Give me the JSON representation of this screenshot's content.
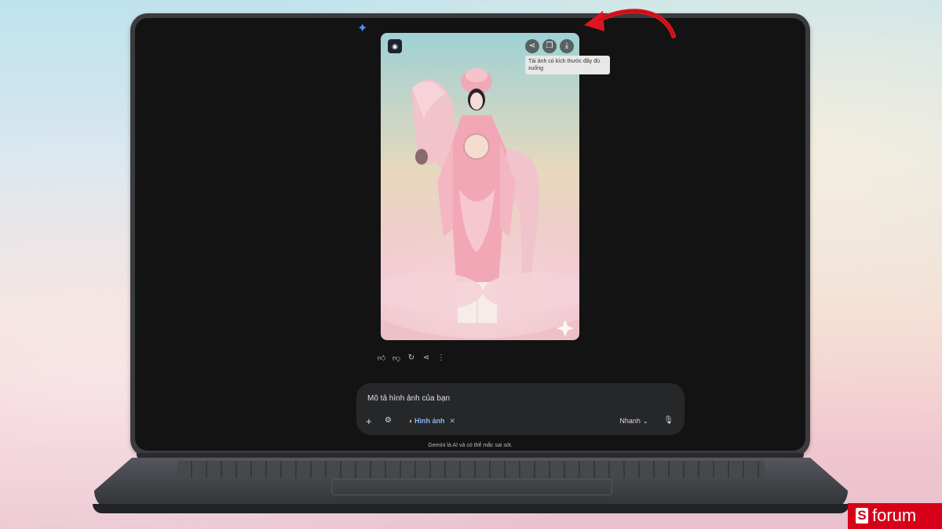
{
  "image_toolbar": {
    "share_icon": "share-icon",
    "copy_icon": "copy-icon",
    "download_icon": "download-icon",
    "download_tooltip": "Tải ảnh có kích thước đầy đủ xuống"
  },
  "response_actions": [
    "thumbs-up-icon",
    "thumbs-down-icon",
    "refresh-icon",
    "share-icon",
    "more-icon"
  ],
  "composer": {
    "placeholder": "Mô tả hình ảnh của bạn",
    "tool_chip": "Hình ảnh",
    "tool_chip_remove": "✕",
    "model_label": "Nhanh"
  },
  "disclaimer": "Gemini là AI và có thể mắc sai sót.",
  "watermark": {
    "s": "S",
    "text": "forum"
  },
  "colors": {
    "accent_blue": "#4c8df6",
    "chip_blue": "#8ab4f8",
    "brand_red": "#d70018",
    "arrow_red": "#e0141e"
  }
}
